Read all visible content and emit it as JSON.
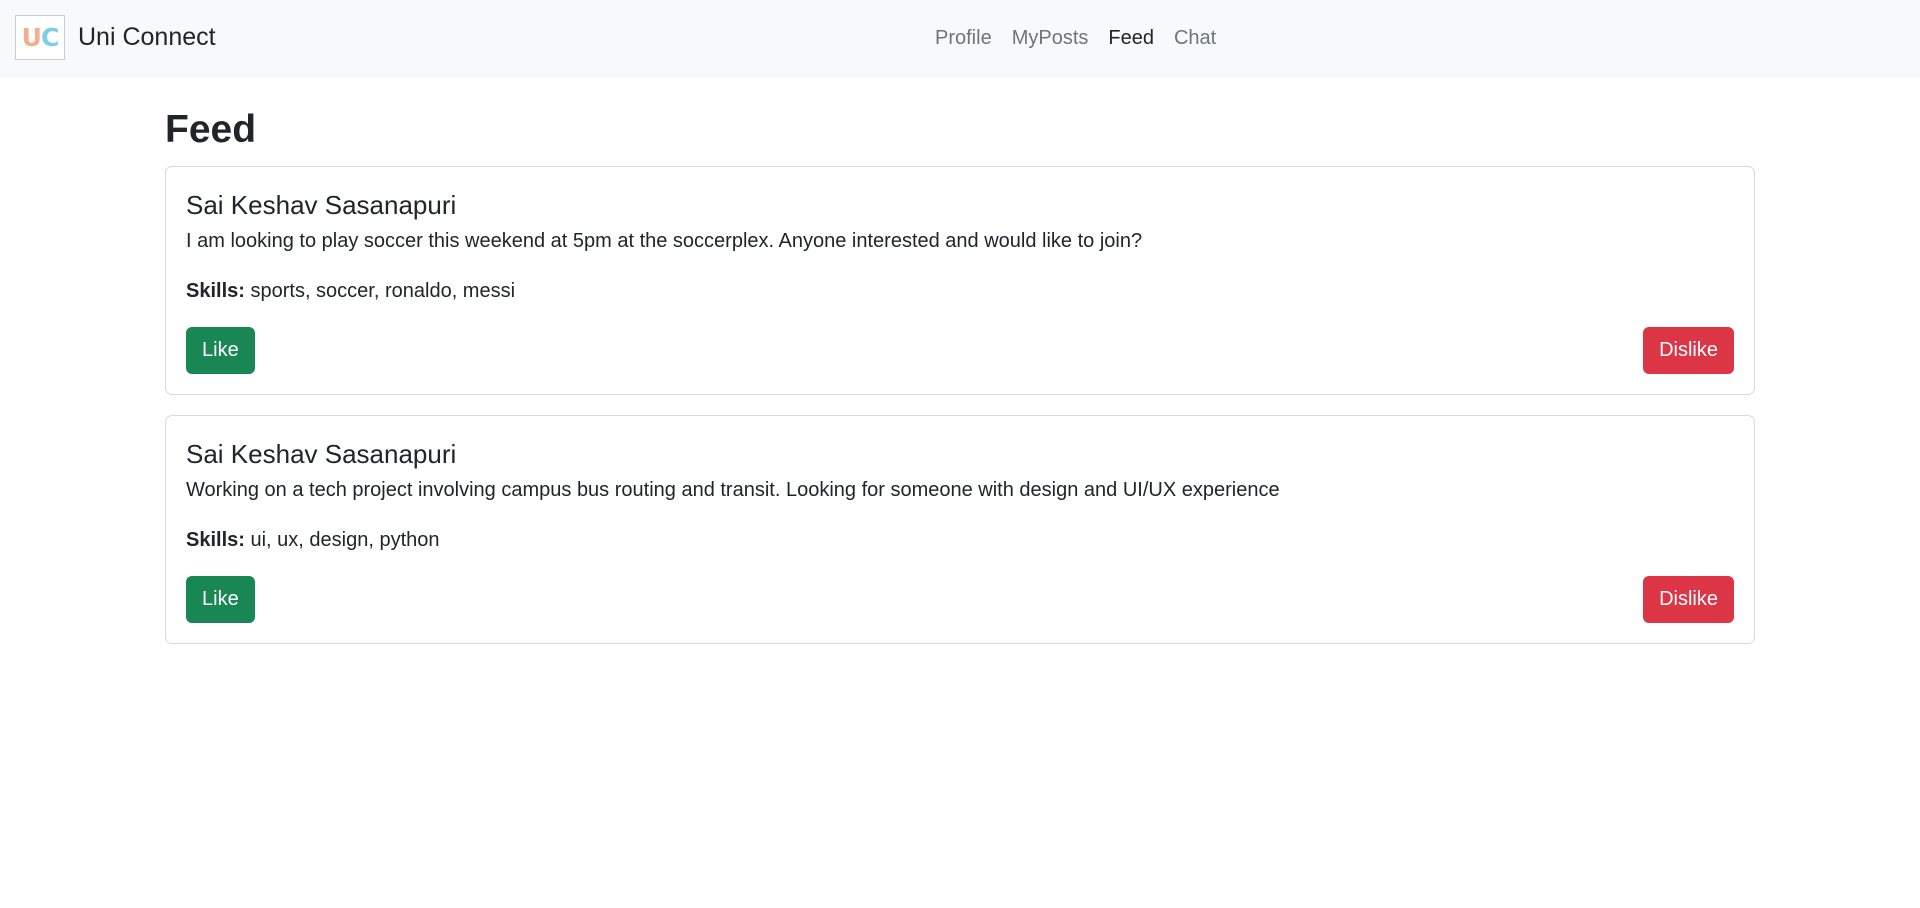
{
  "navbar": {
    "logo_text_u": "U",
    "logo_text_c": "C",
    "brand": "Uni Connect",
    "links": [
      {
        "label": "Profile",
        "active": false
      },
      {
        "label": "MyPosts",
        "active": false
      },
      {
        "label": "Feed",
        "active": true
      },
      {
        "label": "Chat",
        "active": false
      }
    ]
  },
  "page": {
    "title": "Feed"
  },
  "posts": [
    {
      "author": "Sai Keshav Sasanapuri",
      "content": "I am looking to play soccer this weekend at 5pm at the soccerplex. Anyone interested and would like to join?",
      "skills_label": "Skills:",
      "skills": "sports, soccer, ronaldo, messi",
      "like_label": "Like",
      "dislike_label": "Dislike"
    },
    {
      "author": "Sai Keshav Sasanapuri",
      "content": "Working on a tech project involving campus bus routing and transit. Looking for someone with design and UI/UX experience",
      "skills_label": "Skills:",
      "skills": "ui, ux, design, python",
      "like_label": "Like",
      "dislike_label": "Dislike"
    }
  ],
  "colors": {
    "navbar_bg": "#f8f9fa",
    "like": "#198754",
    "dislike": "#dc3545"
  }
}
